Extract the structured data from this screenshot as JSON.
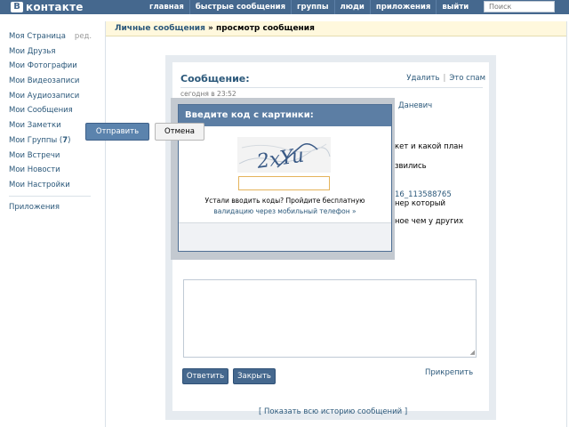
{
  "header": {
    "logo_letter": "В",
    "logo_text": "контакте",
    "nav": [
      "главная",
      "быстрые сообщения",
      "группы",
      "люди",
      "приложения",
      "выйти"
    ],
    "search_placeholder": "Поиск"
  },
  "leftmenu": {
    "my_page": "Моя Страница",
    "edit": "ред.",
    "items": [
      "Мои Друзья",
      "Мои Фотографии",
      "Мои Видеозаписи",
      "Мои Аудиозаписи",
      "Мои Сообщения",
      "Мои Заметки"
    ],
    "groups_label": "Мои Группы (",
    "groups_count": "7",
    "groups_close": ")",
    "items2": [
      "Мои Встречи",
      "Мои Новости",
      "Мои Настройки"
    ],
    "apps": "Приложения"
  },
  "breadcrumb": {
    "link": "Личные сообщения",
    "separator": " » ",
    "current": "просмотр сообщения"
  },
  "message": {
    "title": "Сообщение:",
    "delete": "Удалить",
    "separator": "|",
    "spam": "Это спам",
    "date": "сегодня в 23:52",
    "fragments": [
      "Даневич",
      "кет и какой план",
      "звились",
      "16_113588765",
      "нер который",
      "ное чем у других"
    ],
    "reply_button": "Ответить",
    "close_button": "Закрыть",
    "attach": "Прикрепить",
    "history": "[ Показать всю историю сообщений ]"
  },
  "captcha_dialog": {
    "title": "Введите код с картинки:",
    "captcha_text": "2xYu",
    "hint": "Устали вводить коды? Пройдите бесплатную",
    "hint_link": "валидацию через мобильный телефон »",
    "send": "Отправить",
    "cancel": "Отмена"
  },
  "colors": {
    "header": "#45688e",
    "link": "#2b587a",
    "crumb_bg": "#fff8dd",
    "dialog_head": "#5c7ea4"
  }
}
